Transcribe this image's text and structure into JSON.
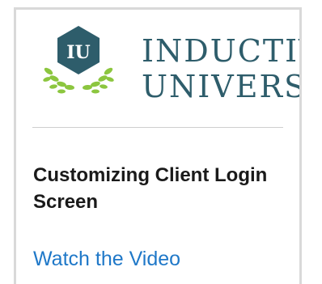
{
  "logo": {
    "badge_text": "IU",
    "line1": "INDUCTIVE",
    "line2": "UNIVERSITY",
    "colors": {
      "badge": "#2e5d6b",
      "laurel": "#8cc63f",
      "text": "#2e5d6b"
    }
  },
  "lesson": {
    "title": "Customizing Client Login Screen",
    "link_label": "Watch the Video"
  }
}
